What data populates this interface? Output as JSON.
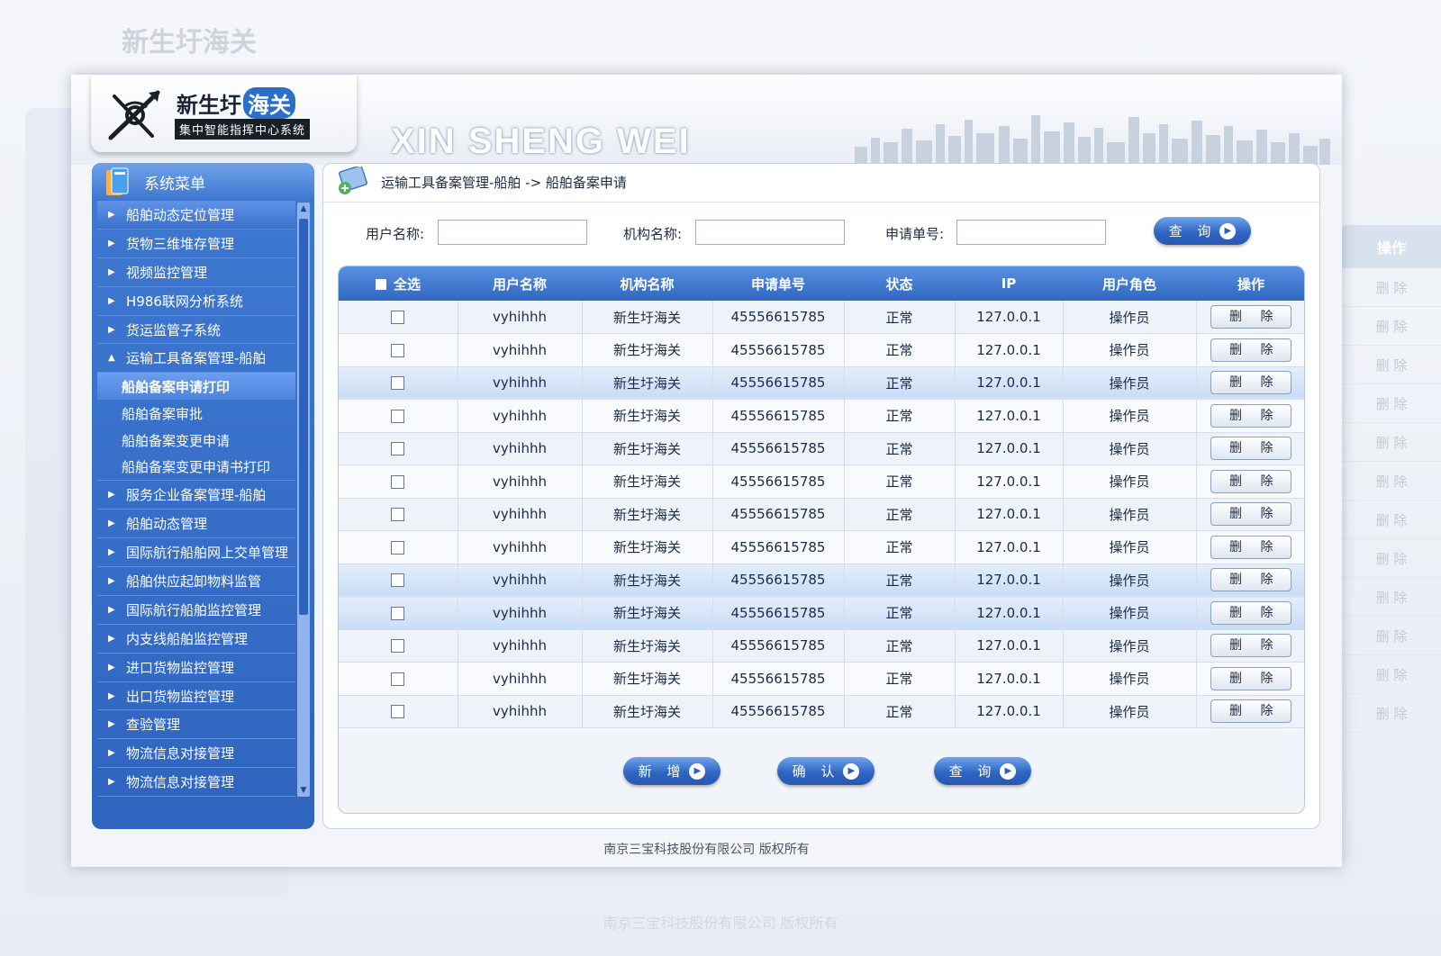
{
  "header": {
    "logo_title": "新生圩",
    "logo_highlight": "海关",
    "logo_subtitle": "集中智能指挥中心系统",
    "brand": "XIN SHENG WEI"
  },
  "sidebar": {
    "title": "系统菜单",
    "items": [
      {
        "label": "船舶动态定位管理",
        "type": "top"
      },
      {
        "label": "货物三维堆存管理",
        "type": "top"
      },
      {
        "label": "视频监控管理",
        "type": "top"
      },
      {
        "label": "H986联网分析系统",
        "type": "top"
      },
      {
        "label": "货运监管子系统",
        "type": "top"
      },
      {
        "label": "运输工具备案管理-船舶",
        "type": "open"
      },
      {
        "label": "船舶备案申请打印",
        "type": "sub-current"
      },
      {
        "label": "船舶备案审批",
        "type": "sub"
      },
      {
        "label": "船舶备案变更申请",
        "type": "sub"
      },
      {
        "label": "船舶备案变更申请书打印",
        "type": "sub"
      },
      {
        "label": "服务企业备案管理-船舶",
        "type": "top"
      },
      {
        "label": "船舶动态管理",
        "type": "top"
      },
      {
        "label": "国际航行船舶网上交单管理",
        "type": "top"
      },
      {
        "label": "船舶供应起卸物料监管",
        "type": "top"
      },
      {
        "label": "国际航行船舶监控管理",
        "type": "top"
      },
      {
        "label": "内支线船舶监控管理",
        "type": "top"
      },
      {
        "label": "进口货物监控管理",
        "type": "top"
      },
      {
        "label": "出口货物监控管理",
        "type": "top"
      },
      {
        "label": "查验管理",
        "type": "top"
      },
      {
        "label": "物流信息对接管理",
        "type": "top"
      },
      {
        "label": "物流信息对接管理",
        "type": "top"
      }
    ]
  },
  "breadcrumb": "运输工具备案管理-船舶 -> 船舶备案申请",
  "filters": {
    "user_label": "用户名称:",
    "user_value": "",
    "org_label": "机构名称:",
    "org_value": "",
    "app_label": "申请单号:",
    "app_value": "",
    "search_button": "查 询"
  },
  "table": {
    "columns": [
      "全选",
      "用户名称",
      "机构名称",
      "申请单号",
      "状态",
      "IP",
      "用户角色",
      "操作"
    ],
    "delete_label": "删 除",
    "rows": [
      {
        "user": "vyhihhh",
        "org": "新生圩海关",
        "app_no": "45556615785",
        "status": "正常",
        "ip": "127.0.0.1",
        "role": "操作员",
        "style": "odd"
      },
      {
        "user": "vyhihhh",
        "org": "新生圩海关",
        "app_no": "45556615785",
        "status": "正常",
        "ip": "127.0.0.1",
        "role": "操作员",
        "style": "even"
      },
      {
        "user": "vyhihhh",
        "org": "新生圩海关",
        "app_no": "45556615785",
        "status": "正常",
        "ip": "127.0.0.1",
        "role": "操作员",
        "style": "hl"
      },
      {
        "user": "vyhihhh",
        "org": "新生圩海关",
        "app_no": "45556615785",
        "status": "正常",
        "ip": "127.0.0.1",
        "role": "操作员",
        "style": "even"
      },
      {
        "user": "vyhihhh",
        "org": "新生圩海关",
        "app_no": "45556615785",
        "status": "正常",
        "ip": "127.0.0.1",
        "role": "操作员",
        "style": "odd"
      },
      {
        "user": "vyhihhh",
        "org": "新生圩海关",
        "app_no": "45556615785",
        "status": "正常",
        "ip": "127.0.0.1",
        "role": "操作员",
        "style": "even"
      },
      {
        "user": "vyhihhh",
        "org": "新生圩海关",
        "app_no": "45556615785",
        "status": "正常",
        "ip": "127.0.0.1",
        "role": "操作员",
        "style": "odd"
      },
      {
        "user": "vyhihhh",
        "org": "新生圩海关",
        "app_no": "45556615785",
        "status": "正常",
        "ip": "127.0.0.1",
        "role": "操作员",
        "style": "even"
      },
      {
        "user": "vyhihhh",
        "org": "新生圩海关",
        "app_no": "45556615785",
        "status": "正常",
        "ip": "127.0.0.1",
        "role": "操作员",
        "style": "hl"
      },
      {
        "user": "vyhihhh",
        "org": "新生圩海关",
        "app_no": "45556615785",
        "status": "正常",
        "ip": "127.0.0.1",
        "role": "操作员",
        "style": "hl"
      },
      {
        "user": "vyhihhh",
        "org": "新生圩海关",
        "app_no": "45556615785",
        "status": "正常",
        "ip": "127.0.0.1",
        "role": "操作员",
        "style": "odd"
      },
      {
        "user": "vyhihhh",
        "org": "新生圩海关",
        "app_no": "45556615785",
        "status": "正常",
        "ip": "127.0.0.1",
        "role": "操作员",
        "style": "even"
      },
      {
        "user": "vyhihhh",
        "org": "新生圩海关",
        "app_no": "45556615785",
        "status": "正常",
        "ip": "127.0.0.1",
        "role": "操作员",
        "style": "odd"
      }
    ]
  },
  "actions": {
    "add": "新 增",
    "confirm": "确 认",
    "query": "查 询"
  },
  "footer": "南京三宝科技股份有限公司  版权所有",
  "colors": {
    "accent": "#2f67c2",
    "sidebar": "#3f79d2",
    "header_row": "#4a82d6"
  }
}
